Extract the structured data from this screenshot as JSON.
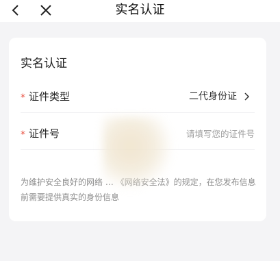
{
  "nav": {
    "title": "实名认证",
    "back_icon": "chevron-left-icon",
    "close_icon": "close-icon"
  },
  "card": {
    "title": "实名认证",
    "required_mark": "*",
    "id_type": {
      "label": "证件类型",
      "value": "二代身份证"
    },
    "id_number": {
      "label": "证件号",
      "placeholder": "请填写您的证件号"
    },
    "notice": "为维护安全良好的网络 … 《网络安全法》的规定，在您发布信息前需要提供真实的身份信息"
  },
  "colors": {
    "required": "#e84b3b",
    "background": "#f4f4f6",
    "card": "#ffffff"
  }
}
